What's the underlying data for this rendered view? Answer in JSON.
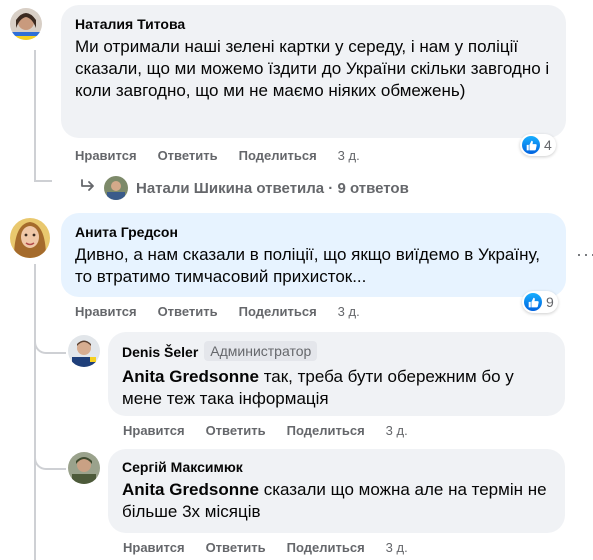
{
  "actions": {
    "like": "Нравится",
    "reply": "Ответить",
    "share": "Поделиться"
  },
  "comments": [
    {
      "author": "Наталия Титова",
      "text": "Ми отримали наші зелені картки у середу, і нам у поліції сказали, що ми можемо їздити до України скільки завгодно і коли завгодно, що ми не маємо ніяких обмежень)",
      "time": "3 д.",
      "reactions": "4",
      "replies": {
        "author": "Натали Шикина",
        "label": "ответила · 9 ответов"
      }
    },
    {
      "author": "Анита Гредсон",
      "text": "Дивно, а нам сказали в поліції, що якщо виїдемо в Україну, то втратимо тимчасовий прихисток...",
      "time": "3 д.",
      "reactions": "9"
    }
  ],
  "replies": [
    {
      "author": "Denis Šeler",
      "badge": "Администратор",
      "mention": "Anita Gredsonne",
      "text": " так, треба бути обережним бо у мене теж така інформація",
      "time": "3 д."
    },
    {
      "author": "Сергій Максимюк",
      "mention": "Anita Gredsonne",
      "text": " сказали що можна але на термін не більше 3х місяців",
      "time": "3 д."
    }
  ],
  "colors": {
    "bubble": "#f0f2f5",
    "highlight": "#e7f3ff",
    "secondary_text": "#65676b",
    "like_blue": "#0866ff"
  }
}
